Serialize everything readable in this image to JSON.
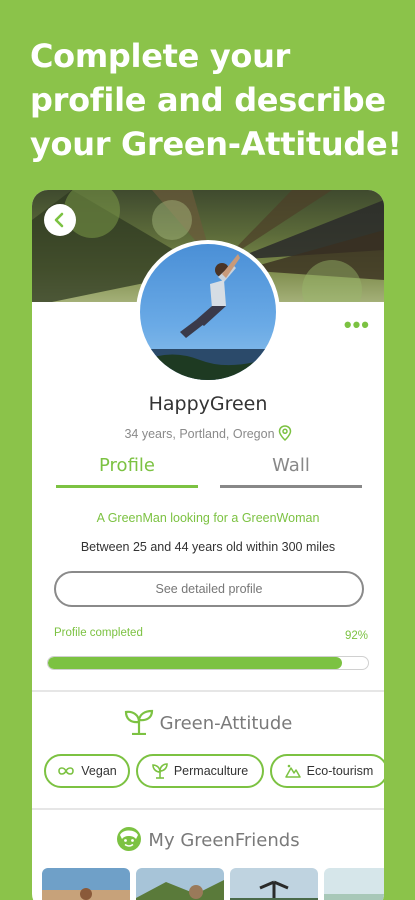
{
  "headline": {
    "line1": "Complete your",
    "line2": "profile and describe",
    "line3": "your Green-Attitude!"
  },
  "profile": {
    "username": "HappyGreen",
    "location": "34 years, Portland, Oregon",
    "more_label": "•••"
  },
  "tabs": [
    {
      "label": "Profile",
      "active": true
    },
    {
      "label": "Wall",
      "active": false
    }
  ],
  "about": {
    "tagline": "A GreenMan looking for a GreenWoman",
    "criteria": "Between 25 and 44 years old within 300 miles",
    "detail_button": "See detailed profile"
  },
  "progress": {
    "label": "Profile completed",
    "percent_label": "92%",
    "value": 0.92
  },
  "green_attitude": {
    "title": "Green-Attitude",
    "chips": [
      {
        "label": "Vegan",
        "icon": "infinity-icon"
      },
      {
        "label": "Permaculture",
        "icon": "plant-icon"
      },
      {
        "label": "Eco-tourism",
        "icon": "mountain-icon"
      }
    ]
  },
  "friends": {
    "title": "My GreenFriends"
  },
  "colors": {
    "background": "#8bc34a",
    "accent": "#7cc242",
    "text": "#333333",
    "muted": "#8a8a8a"
  }
}
